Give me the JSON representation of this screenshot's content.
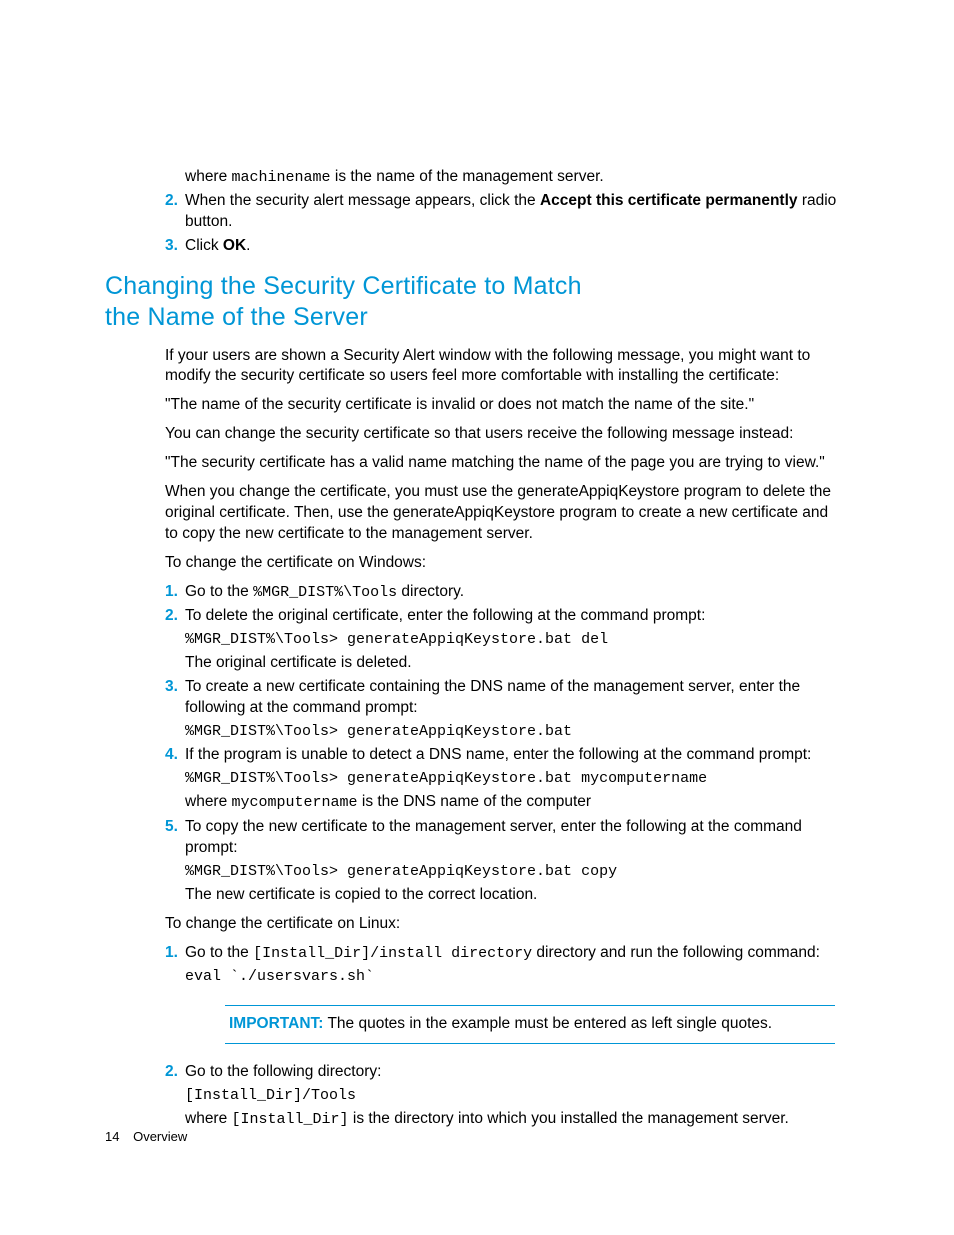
{
  "top": {
    "where_pre": "where ",
    "where_code": "machinename",
    "where_post": " is the name of the management server.",
    "step2_a": "When the security alert message appears, click the ",
    "step2_bold": "Accept this certificate permanently",
    "step2_b": " radio button.",
    "step3_a": "Click ",
    "step3_bold": "OK",
    "step3_b": "."
  },
  "heading": "Changing the Security Certificate to Match\nthe Name of the Server",
  "p1": "If your users are shown a Security Alert window with the following message, you might want to modify the security certificate so users feel more comfortable with installing the certificate:",
  "p2": "\"The name of the security certificate is invalid or does not match the name of the site.\"",
  "p3": "You can change the security certificate so that users receive the following message instead:",
  "p4": "\"The security certificate has a valid name matching the name of the page you are trying to view.\"",
  "p5": "When you change the certificate, you must use the generateAppiqKeystore program to delete the original certificate. Then, use the generateAppiqKeystore program to create a new certificate and to copy the new certificate to the management server.",
  "p6": "To change the certificate on Windows:",
  "win": {
    "s1_a": "Go to the ",
    "s1_code": "%MGR_DIST%\\Tools",
    "s1_b": " directory.",
    "s2": "To delete the original certificate, enter the following at the command prompt:",
    "s2_code": "%MGR_DIST%\\Tools> generateAppiqKeystore.bat del",
    "s2_post": "The original certificate is deleted.",
    "s3": "To create a new certificate containing the DNS name of the management server, enter the following at the command prompt:",
    "s3_code": "%MGR_DIST%\\Tools> generateAppiqKeystore.bat",
    "s4": "If the program is unable to detect a DNS name, enter the following at the command prompt:",
    "s4_code": "%MGR_DIST%\\Tools> generateAppiqKeystore.bat mycomputername",
    "s4_post_a": "where ",
    "s4_post_code": "mycomputername",
    "s4_post_b": " is the DNS name of the computer",
    "s5": "To copy the new certificate to the management server, enter the following at the command prompt:",
    "s5_code": "%MGR_DIST%\\Tools> generateAppiqKeystore.bat copy",
    "s5_post": "The new certificate is copied to the correct location."
  },
  "p7": "To change the certificate on Linux:",
  "lin": {
    "s1_a": "Go to the ",
    "s1_code": "[Install_Dir]/install directory",
    "s1_b": " directory and run the following command:",
    "s1_cmd": "eval `./usersvars.sh`",
    "note_label": "IMPORTANT:",
    "note_text": "   The quotes in the example must be entered as left single quotes.",
    "s2": "Go to the following directory:",
    "s2_code": "[Install_Dir]/Tools",
    "s2_post_a": "where ",
    "s2_post_code": "[Install_Dir]",
    "s2_post_b": " is the directory into which you installed the management server."
  },
  "footer": {
    "page": "14",
    "section": "Overview"
  }
}
